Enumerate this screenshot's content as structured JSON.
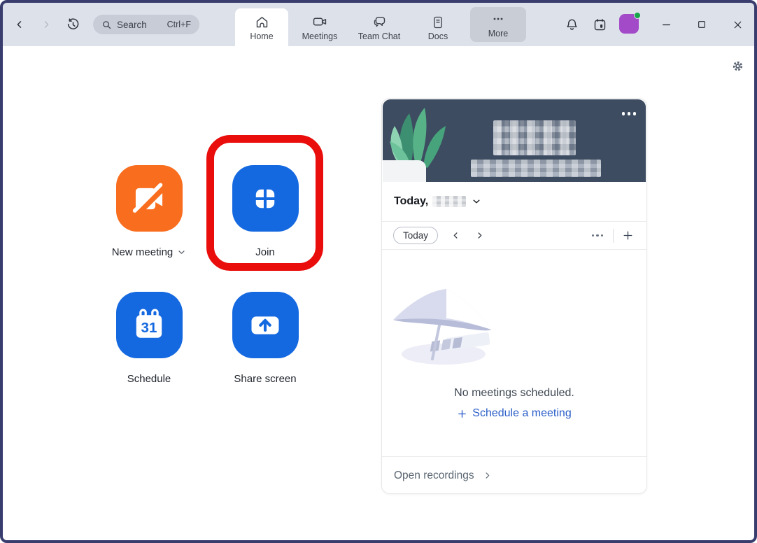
{
  "colors": {
    "accent_blue": "#1569e0",
    "accent_orange": "#f96d1e",
    "annotation_red": "#e90d0c",
    "banner_slate": "#3d4c61",
    "link_blue": "#2a5dc8",
    "avatar_purple": "#a34ac9",
    "presence_green": "#17a34a"
  },
  "titlebar": {
    "search": {
      "label": "Search",
      "shortcut": "Ctrl+F"
    },
    "tabs": [
      {
        "label": "Home",
        "active": true
      },
      {
        "label": "Meetings",
        "active": false
      },
      {
        "label": "Team Chat",
        "active": false
      },
      {
        "label": "Docs",
        "active": false
      },
      {
        "label": "More",
        "active": false,
        "highlighted": true
      }
    ]
  },
  "home": {
    "actions": [
      {
        "label": "New meeting",
        "has_dropdown": true,
        "icon": "video-off-icon"
      },
      {
        "label": "Join",
        "icon": "plus-square-icon",
        "annotated": "red box highlight"
      },
      {
        "label": "Schedule",
        "icon": "calendar-icon",
        "icon_text": "31"
      },
      {
        "label": "Share screen",
        "icon": "share-up-icon"
      }
    ]
  },
  "panel": {
    "banner": {
      "menu_icon": "ellipsis",
      "artwork": "plant-illustration",
      "redacted_lines": 2
    },
    "date_label": "Today,",
    "toolbar": {
      "today": "Today"
    },
    "empty": {
      "illustration": "beach-umbrella",
      "message": "No meetings scheduled.",
      "cta": "Schedule a meeting"
    },
    "footer": {
      "label": "Open recordings"
    }
  }
}
